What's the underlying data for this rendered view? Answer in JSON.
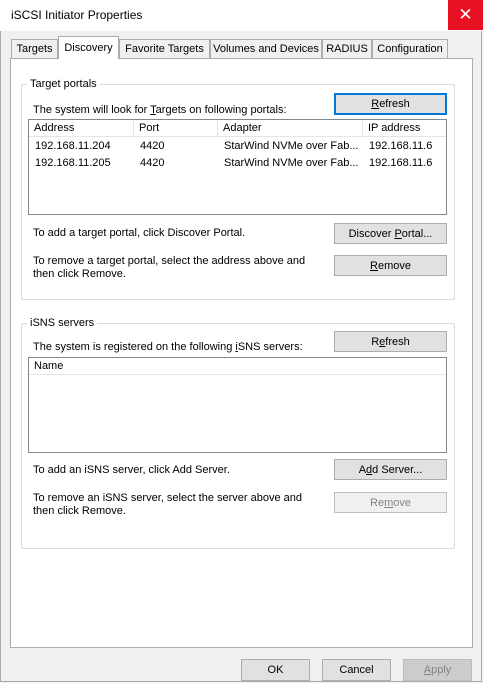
{
  "window": {
    "title": "iSCSI Initiator Properties",
    "close_glyph": "✕"
  },
  "tabs": [
    {
      "label": "Targets"
    },
    {
      "label": "Discovery"
    },
    {
      "label": "Favorite Targets"
    },
    {
      "label": "Volumes and Devices"
    },
    {
      "label": "RADIUS"
    },
    {
      "label": "Configuration"
    }
  ],
  "target_portals": {
    "title": "Target portals",
    "intro": "The system will look for Targets on following portals:",
    "refresh_label": "Refresh",
    "columns": [
      "Address",
      "Port",
      "Adapter",
      "IP address"
    ],
    "rows": [
      {
        "address": "192.168.11.204",
        "port": "4420",
        "adapter": "StarWind NVMe over Fab...",
        "ip": "192.168.11.6"
      },
      {
        "address": "192.168.11.205",
        "port": "4420",
        "adapter": "StarWind NVMe over Fab...",
        "ip": "192.168.11.6"
      }
    ],
    "add_text": "To add a target portal, click Discover Portal.",
    "discover_label": "Discover Portal...",
    "remove_text_1": "To remove a target portal, select the address above and",
    "remove_text_2": "then click Remove.",
    "remove_label": "Remove"
  },
  "isns": {
    "title": "iSNS servers",
    "intro": "The system is registered on the following iSNS servers:",
    "refresh_label": "Refresh",
    "columns": [
      "Name"
    ],
    "add_text": "To add an iSNS server, click Add Server.",
    "add_label": "Add Server...",
    "remove_text_1": "To remove an iSNS server, select the server above and",
    "remove_text_2": "then click Remove.",
    "remove_label": "Remove"
  },
  "footer": {
    "ok_label": "OK",
    "cancel_label": "Cancel",
    "apply_label": "Apply"
  }
}
